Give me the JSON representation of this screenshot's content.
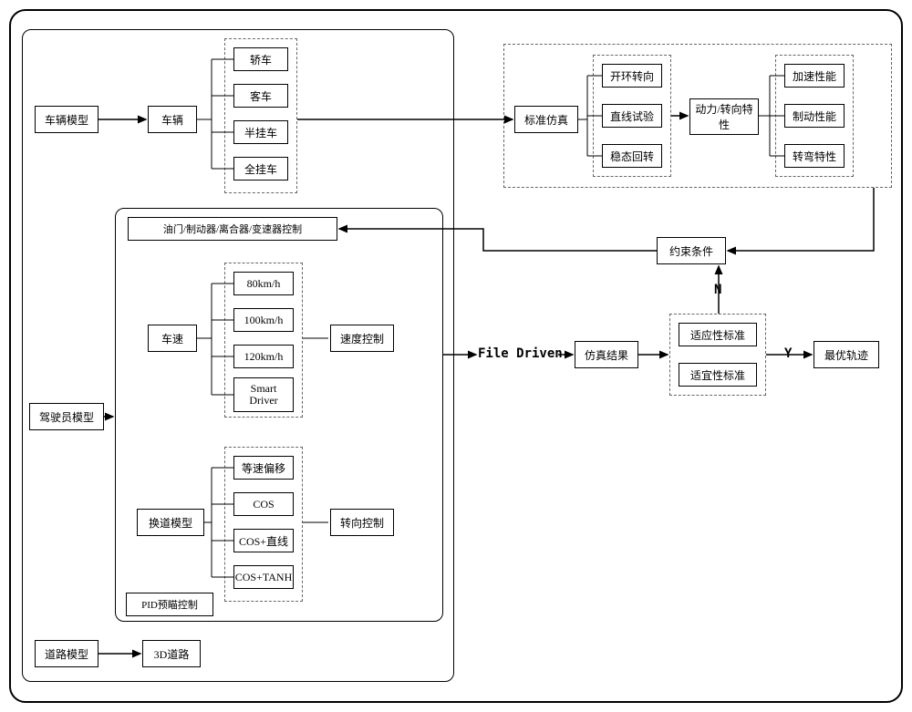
{
  "left": {
    "model_labels": {
      "vehicle": "车辆模型",
      "driver": "驾驶员模型",
      "road": "道路模型"
    },
    "vehicle_block": {
      "vehicle": "车辆",
      "types": [
        "轿车",
        "客车",
        "半挂车",
        "全挂车"
      ]
    },
    "driver_block": {
      "tbcg": "油门/制动器/离合器/变速器控制",
      "speed_label": "车速",
      "speeds": [
        "80km/h",
        "100km/h",
        "120km/h",
        "Smart\nDriver"
      ],
      "speed_ctrl": "速度控制",
      "lane_label": "换道模型",
      "lane_options": [
        "等速偏移",
        "COS",
        "COS+直线",
        "COS+TANH"
      ],
      "steer_ctrl": "转向控制",
      "pid": "PID预瞄控制"
    },
    "road_block": {
      "road3d": "3D道路"
    }
  },
  "right": {
    "std_sim": "标准仿真",
    "sim_tests": [
      "开环转向",
      "直线试验",
      "稳态回转"
    ],
    "dyn_steer": "动力/转向特性",
    "perf": [
      "加速性能",
      "制动性能",
      "转弯特性"
    ],
    "constraint": "约束条件",
    "file_driven": "File Driven",
    "sim_result": "仿真结果",
    "criteria": [
      "适应性标准",
      "适宜性标准"
    ],
    "best_traj": "最优轨迹",
    "branch_n": "N",
    "branch_y": "Y"
  }
}
